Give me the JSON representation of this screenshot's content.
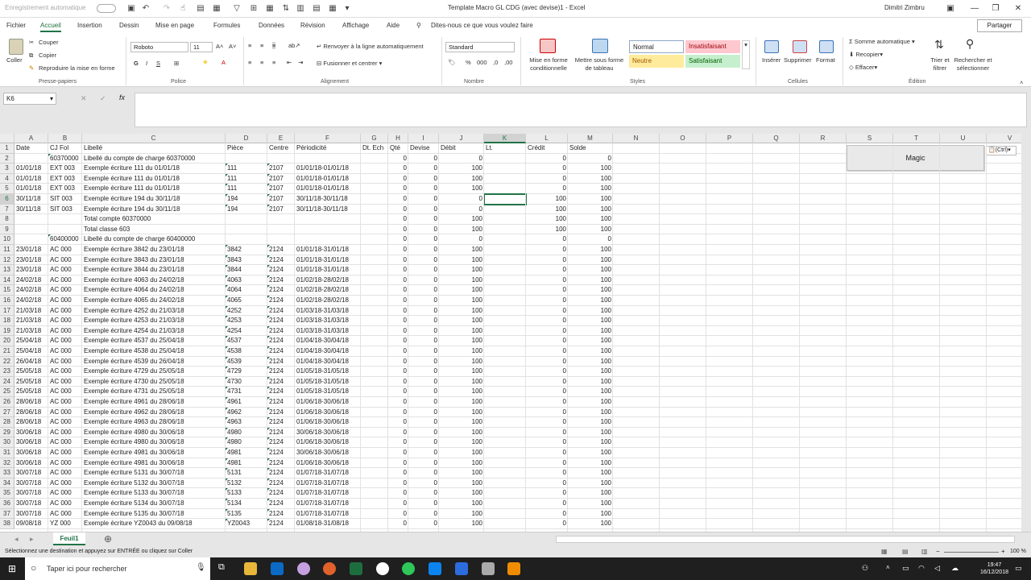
{
  "titlebar": {
    "autosave": "Enregistrement automatique",
    "autosave_state": "Désactivé",
    "title": "Template Macro GL CDG (avec devise)1  -  Excel",
    "user": "Dimitri Zimbru"
  },
  "tabs": [
    "Fichier",
    "Accueil",
    "Insertion",
    "Dessin",
    "Mise en page",
    "Formules",
    "Données",
    "Révision",
    "Affichage",
    "Aide"
  ],
  "tell_me": "Dites-nous ce que vous voulez faire",
  "share": "Partager",
  "ribbon": {
    "clipboard": {
      "paste": "Coller",
      "cut": "Couper",
      "copy": "Copier",
      "format_painter": "Reproduire la mise en forme",
      "group": "Presse-papiers"
    },
    "font": {
      "name": "Roboto",
      "size": "11",
      "group": "Police"
    },
    "alignment": {
      "wrap": "Renvoyer à la ligne automatiquement",
      "merge": "Fusionner et centrer",
      "group": "Alignement"
    },
    "number": {
      "format": "Standard",
      "group": "Nombre"
    },
    "styles": {
      "cond": "Mise en forme conditionnelle",
      "table": "Mettre sous forme de tableau",
      "normal": "Normal",
      "bad": "Insatisfaisant",
      "neutral": "Neutre",
      "good": "Satisfaisant",
      "group": "Styles"
    },
    "cells": {
      "insert": "Insérer",
      "delete": "Supprimer",
      "format": "Format",
      "group": "Cellules"
    },
    "editing": {
      "autosum": "Somme automatique",
      "fill": "Recopier",
      "clear": "Effacer",
      "sort": "Trier et filtrer",
      "find": "Rechercher et sélectionner",
      "group": "Édition"
    }
  },
  "namebox": "K6",
  "formula": "",
  "columns": [
    "A",
    "B",
    "C",
    "D",
    "E",
    "F",
    "G",
    "H",
    "I",
    "J",
    "K",
    "L",
    "M",
    "N",
    "O",
    "P",
    "Q",
    "R",
    "S",
    "T",
    "U",
    "V"
  ],
  "header_row": [
    "Date",
    "CJ Fol",
    "Libellé",
    "Pièce",
    "Centre",
    "Périodicité",
    "Dt. Ech",
    "Qté",
    "Devise",
    "Débit",
    "Lt.",
    "Crédit",
    "Solde"
  ],
  "rows": [
    [
      "",
      "60370000",
      "Libellé du compte de charge 60370000",
      "",
      "",
      "",
      "",
      "0",
      "0",
      "0",
      "",
      "0",
      "0"
    ],
    [
      "01/01/18",
      "EXT 003",
      "Exemple écriture 111 du 01/01/18",
      "111",
      "2107",
      "01/01/18-01/01/18",
      "",
      "0",
      "0",
      "100",
      "",
      "0",
      "100"
    ],
    [
      "01/01/18",
      "EXT 003",
      "Exemple écriture 111 du 01/01/18",
      "111",
      "2107",
      "01/01/18-01/01/18",
      "",
      "0",
      "0",
      "100",
      "",
      "0",
      "100"
    ],
    [
      "01/01/18",
      "EXT 003",
      "Exemple écriture 111 du 01/01/18",
      "111",
      "2107",
      "01/01/18-01/01/18",
      "",
      "0",
      "0",
      "100",
      "",
      "0",
      "100"
    ],
    [
      "30/11/18",
      "SIT 003",
      "Exemple écriture 194 du 30/11/18",
      "194",
      "2107",
      "30/11/18-30/11/18",
      "",
      "0",
      "0",
      "0",
      "",
      "100",
      "100"
    ],
    [
      "30/11/18",
      "SIT 003",
      "Exemple écriture 194 du 30/11/18",
      "194",
      "2107",
      "30/11/18-30/11/18",
      "",
      "0",
      "0",
      "0",
      "",
      "100",
      "100"
    ],
    [
      "",
      "",
      "Total compte 60370000",
      "",
      "",
      "",
      "",
      "0",
      "0",
      "100",
      "",
      "100",
      "100"
    ],
    [
      "",
      "",
      "Total classe 603",
      "",
      "",
      "",
      "",
      "0",
      "0",
      "100",
      "",
      "100",
      "100"
    ],
    [
      "",
      "60400000",
      "Libellé du compte de charge 60400000",
      "",
      "",
      "",
      "",
      "0",
      "0",
      "0",
      "",
      "0",
      "0"
    ],
    [
      "23/01/18",
      "AC  000",
      "Exemple écriture 3842 du 23/01/18",
      "3842",
      "2124",
      "01/01/18-31/01/18",
      "",
      "0",
      "0",
      "100",
      "",
      "0",
      "100"
    ],
    [
      "23/01/18",
      "AC  000",
      "Exemple écriture 3843 du 23/01/18",
      "3843",
      "2124",
      "01/01/18-31/01/18",
      "",
      "0",
      "0",
      "100",
      "",
      "0",
      "100"
    ],
    [
      "23/01/18",
      "AC  000",
      "Exemple écriture 3844 du 23/01/18",
      "3844",
      "2124",
      "01/01/18-31/01/18",
      "",
      "0",
      "0",
      "100",
      "",
      "0",
      "100"
    ],
    [
      "24/02/18",
      "AC  000",
      "Exemple écriture 4063 du 24/02/18",
      "4063",
      "2124",
      "01/02/18-28/02/18",
      "",
      "0",
      "0",
      "100",
      "",
      "0",
      "100"
    ],
    [
      "24/02/18",
      "AC  000",
      "Exemple écriture 4064 du 24/02/18",
      "4064",
      "2124",
      "01/02/18-28/02/18",
      "",
      "0",
      "0",
      "100",
      "",
      "0",
      "100"
    ],
    [
      "24/02/18",
      "AC  000",
      "Exemple écriture 4065 du 24/02/18",
      "4065",
      "2124",
      "01/02/18-28/02/18",
      "",
      "0",
      "0",
      "100",
      "",
      "0",
      "100"
    ],
    [
      "21/03/18",
      "AC  000",
      "Exemple écriture 4252 du 21/03/18",
      "4252",
      "2124",
      "01/03/18-31/03/18",
      "",
      "0",
      "0",
      "100",
      "",
      "0",
      "100"
    ],
    [
      "21/03/18",
      "AC  000",
      "Exemple écriture 4253 du 21/03/18",
      "4253",
      "2124",
      "01/03/18-31/03/18",
      "",
      "0",
      "0",
      "100",
      "",
      "0",
      "100"
    ],
    [
      "21/03/18",
      "AC  000",
      "Exemple écriture 4254 du 21/03/18",
      "4254",
      "2124",
      "01/03/18-31/03/18",
      "",
      "0",
      "0",
      "100",
      "",
      "0",
      "100"
    ],
    [
      "25/04/18",
      "AC  000",
      "Exemple écriture 4537 du 25/04/18",
      "4537",
      "2124",
      "01/04/18-30/04/18",
      "",
      "0",
      "0",
      "100",
      "",
      "0",
      "100"
    ],
    [
      "25/04/18",
      "AC  000",
      "Exemple écriture 4538 du 25/04/18",
      "4538",
      "2124",
      "01/04/18-30/04/18",
      "",
      "0",
      "0",
      "100",
      "",
      "0",
      "100"
    ],
    [
      "26/04/18",
      "AC  000",
      "Exemple écriture 4539 du 26/04/18",
      "4539",
      "2124",
      "01/04/18-30/04/18",
      "",
      "0",
      "0",
      "100",
      "",
      "0",
      "100"
    ],
    [
      "25/05/18",
      "AC  000",
      "Exemple écriture 4729 du 25/05/18",
      "4729",
      "2124",
      "01/05/18-31/05/18",
      "",
      "0",
      "0",
      "100",
      "",
      "0",
      "100"
    ],
    [
      "25/05/18",
      "AC  000",
      "Exemple écriture 4730 du 25/05/18",
      "4730",
      "2124",
      "01/05/18-31/05/18",
      "",
      "0",
      "0",
      "100",
      "",
      "0",
      "100"
    ],
    [
      "25/05/18",
      "AC  000",
      "Exemple écriture 4731 du 25/05/18",
      "4731",
      "2124",
      "01/05/18-31/05/18",
      "",
      "0",
      "0",
      "100",
      "",
      "0",
      "100"
    ],
    [
      "28/06/18",
      "AC  000",
      "Exemple écriture 4961 du 28/06/18",
      "4961",
      "2124",
      "01/06/18-30/06/18",
      "",
      "0",
      "0",
      "100",
      "",
      "0",
      "100"
    ],
    [
      "28/06/18",
      "AC  000",
      "Exemple écriture 4962 du 28/06/18",
      "4962",
      "2124",
      "01/06/18-30/06/18",
      "",
      "0",
      "0",
      "100",
      "",
      "0",
      "100"
    ],
    [
      "28/06/18",
      "AC  000",
      "Exemple écriture 4963 du 28/06/18",
      "4963",
      "2124",
      "01/06/18-30/06/18",
      "",
      "0",
      "0",
      "100",
      "",
      "0",
      "100"
    ],
    [
      "30/06/18",
      "AC  000",
      "Exemple écriture 4980 du 30/06/18",
      "4980",
      "2124",
      "30/06/18-30/06/18",
      "",
      "0",
      "0",
      "100",
      "",
      "0",
      "100"
    ],
    [
      "30/06/18",
      "AC  000",
      "Exemple écriture 4980 du 30/06/18",
      "4980",
      "2124",
      "01/06/18-30/06/18",
      "",
      "0",
      "0",
      "100",
      "",
      "0",
      "100"
    ],
    [
      "30/06/18",
      "AC  000",
      "Exemple écriture 4981 du 30/06/18",
      "4981",
      "2124",
      "30/06/18-30/06/18",
      "",
      "0",
      "0",
      "100",
      "",
      "0",
      "100"
    ],
    [
      "30/06/18",
      "AC  000",
      "Exemple écriture 4981 du 30/06/18",
      "4981",
      "2124",
      "01/06/18-30/06/18",
      "",
      "0",
      "0",
      "100",
      "",
      "0",
      "100"
    ],
    [
      "30/07/18",
      "AC  000",
      "Exemple écriture 5131 du 30/07/18",
      "5131",
      "2124",
      "01/07/18-31/07/18",
      "",
      "0",
      "0",
      "100",
      "",
      "0",
      "100"
    ],
    [
      "30/07/18",
      "AC  000",
      "Exemple écriture 5132 du 30/07/18",
      "5132",
      "2124",
      "01/07/18-31/07/18",
      "",
      "0",
      "0",
      "100",
      "",
      "0",
      "100"
    ],
    [
      "30/07/18",
      "AC  000",
      "Exemple écriture 5133 du 30/07/18",
      "5133",
      "2124",
      "01/07/18-31/07/18",
      "",
      "0",
      "0",
      "100",
      "",
      "0",
      "100"
    ],
    [
      "30/07/18",
      "AC  000",
      "Exemple écriture 5134 du 30/07/18",
      "5134",
      "2124",
      "01/07/18-31/07/18",
      "",
      "0",
      "0",
      "100",
      "",
      "0",
      "100"
    ],
    [
      "30/07/18",
      "AC  000",
      "Exemple écriture 5135 du 30/07/18",
      "5135",
      "2124",
      "01/07/18-31/07/18",
      "",
      "0",
      "0",
      "100",
      "",
      "0",
      "100"
    ],
    [
      "09/08/18",
      "YZ  000",
      "Exemple écriture YZ0043 du 09/08/18",
      "YZ0043",
      "2124",
      "01/08/18-31/08/18",
      "",
      "0",
      "0",
      "100",
      "",
      "0",
      "100"
    ]
  ],
  "magic_button": "Magic",
  "paste_options": "(Ctrl)",
  "sheet_tab": "Feuil1",
  "status": "Sélectionnez une destination et appuyez sur ENTRÉE ou cliquez sur Coller",
  "zoom": "100 %",
  "taskbar": {
    "search": "Taper ici pour rechercher",
    "time": "19:47",
    "date": "16/12/2018"
  }
}
